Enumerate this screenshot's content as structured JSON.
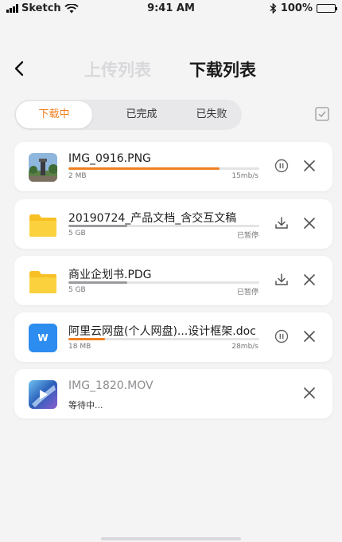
{
  "status_bar": {
    "carrier": "Sketch",
    "time": "9:41 AM",
    "battery": "100%"
  },
  "nav": {
    "tab_upload": "上传列表",
    "tab_download": "下载列表"
  },
  "filter": {
    "downloading": "下载中",
    "completed": "已完成",
    "failed": "已失败"
  },
  "colors": {
    "accent": "#f08021",
    "progress_grey": "#9a9a9e",
    "folder": "#f8c025",
    "doc_blue": "#2d8cf0"
  },
  "items": [
    {
      "name": "IMG_0916.PNG",
      "size": "2 MB",
      "status": "15mb/s",
      "progress": 0.79,
      "icon": "photo-thumbnail",
      "action": "pause-icon"
    },
    {
      "name": "20190724_产品文档_含交互文稿",
      "size": "5 GB",
      "status": "已暂停",
      "progress": 0.31,
      "icon": "folder-icon",
      "action": "download-icon"
    },
    {
      "name": "商业企划书.PDG",
      "size": "5 GB",
      "status": "已暂停",
      "progress": 0.31,
      "icon": "folder-icon",
      "action": "download-icon"
    },
    {
      "name": "阿里云网盘(个人网盘)...设计框架.doc",
      "size": "18 MB",
      "status": "28mb/s",
      "progress": 0.19,
      "icon": "doc-icon",
      "badge": "W",
      "action": "pause-icon"
    },
    {
      "name": "IMG_1820.MOV",
      "waiting": "等待中...",
      "icon": "video-thumbnail",
      "action": "none"
    }
  ]
}
